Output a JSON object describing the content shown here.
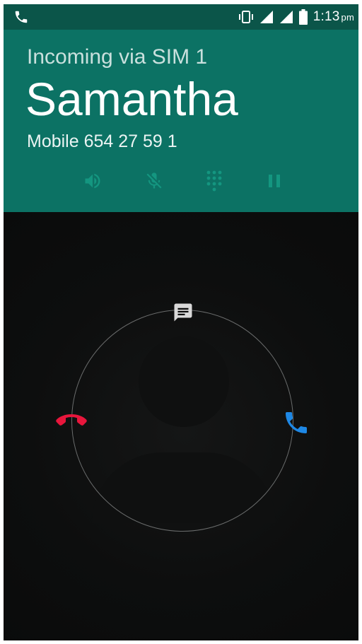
{
  "status_bar": {
    "left_icon": "phone-icon",
    "icons": [
      "vibrate-icon",
      "signal-icon",
      "signal-icon",
      "battery-icon"
    ],
    "time": "1:13",
    "ampm": "pm"
  },
  "call": {
    "incoming_label": "Incoming via SIM 1",
    "caller_name": "Samantha",
    "caller_number": "Mobile 654 27 59 1"
  },
  "controls": [
    {
      "name": "speaker",
      "icon": "speaker-icon",
      "enabled": false
    },
    {
      "name": "mute",
      "icon": "mic-off-icon",
      "enabled": false
    },
    {
      "name": "dialpad",
      "icon": "dialpad-icon",
      "enabled": false
    },
    {
      "name": "hold",
      "icon": "pause-icon",
      "enabled": false
    }
  ],
  "glowpad": {
    "targets": [
      {
        "name": "message",
        "icon": "message-icon",
        "color": "#d9d9d9"
      },
      {
        "name": "decline",
        "icon": "decline-call-icon",
        "color": "#e8163c"
      },
      {
        "name": "answer",
        "icon": "answer-call-icon",
        "color": "#1e88e5"
      }
    ]
  },
  "colors": {
    "status_bar": "#0b5549",
    "header": "#0c7264",
    "background": "#0a0b0b",
    "decline": "#e8163c",
    "answer": "#1e88e5"
  }
}
